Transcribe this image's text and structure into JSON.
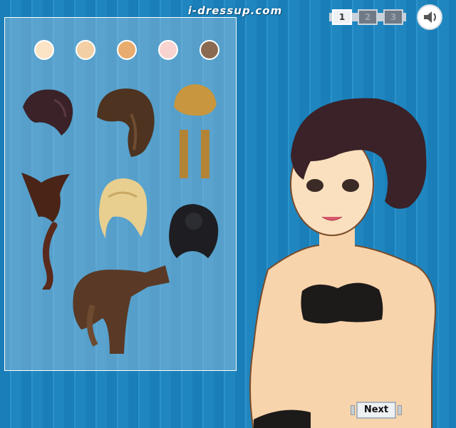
{
  "brand": "i-dressup.com",
  "pages": [
    "1",
    "2",
    "3"
  ],
  "active_page": "1",
  "sound_icon": "speaker-icon",
  "skin_tones": [
    "#fbe3c6",
    "#f2cfa4",
    "#e8ac6e",
    "#f8d3d0",
    "#8a6b52"
  ],
  "hair_options": [
    {
      "name": "dark-updo",
      "color": "#3a2228"
    },
    {
      "name": "long-braid",
      "color": "#4d3320"
    },
    {
      "name": "blonde-bun-pigtails",
      "color": "#b38336"
    },
    {
      "name": "horned-ponytail",
      "color": "#4b2418"
    },
    {
      "name": "blonde-curly-bob",
      "color": "#e8cf8f"
    },
    {
      "name": "black-braided-bun",
      "color": "#1e1e22"
    },
    {
      "name": "brown-braided-side",
      "color": "#5a3a26"
    }
  ],
  "next_label": "Next"
}
